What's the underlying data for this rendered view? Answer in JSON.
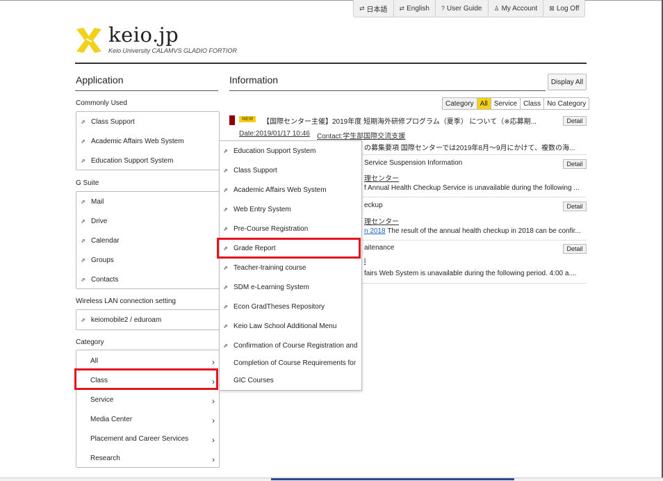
{
  "topnav": [
    {
      "icon": "swap-icon",
      "glyph": "⇄",
      "label": "日本語"
    },
    {
      "icon": "swap-icon",
      "glyph": "⇄",
      "label": "English"
    },
    {
      "icon": "help-icon",
      "glyph": "?",
      "label": "User Guide"
    },
    {
      "icon": "user-icon",
      "glyph": "♙",
      "label": "My Account"
    },
    {
      "icon": "logout-icon",
      "glyph": "⊠",
      "label": "Log Off"
    }
  ],
  "brand": {
    "name": "keio.jp",
    "tagline": "Keio University CALAMVS GLADIO FORTIOR",
    "accent": "#f2d11c"
  },
  "application": {
    "title": "Application",
    "commonly_used_label": "Commonly Used",
    "commonly_used": [
      "Class Support",
      "Academic Affairs Web System",
      "Education Support System"
    ],
    "gsuite_label": "G Suite",
    "gsuite": [
      "Mail",
      "Drive",
      "Calendar",
      "Groups",
      "Contacts"
    ],
    "wireless_label": "Wireless LAN connection setting",
    "wireless": [
      "keiomobile2 / eduroam"
    ],
    "category_label": "Category",
    "categories": [
      "All",
      "Class",
      "Service",
      "Media Center",
      "Placement and Career Services",
      "Research"
    ]
  },
  "information": {
    "title": "Information",
    "display_all": "Display All",
    "filters": [
      "Category",
      "All",
      "Service",
      "Class",
      "No Category"
    ],
    "detail_label": "Detail",
    "news": [
      {
        "badge": "NEW",
        "title": "【国際センター主催】2019年度 短期海外研修プログラム（夏季） について（※応募期...",
        "date": "Date:2019/01/17 10:46",
        "contact": "Contact:学生部国際交流支援",
        "body": "の募集要項 国際センターでは2019年8月～9月にかけて、複数の海..."
      },
      {
        "title": "Service Suspension Information",
        "contact": "理センター",
        "body": "f Annual Health Checkup Service is unavailable during the following ..."
      },
      {
        "title": "eckup",
        "contact": "理センター",
        "link": "n 2018",
        "body": "The result of the annual health checkup in 2018 can be confir..."
      },
      {
        "title": "aitenance",
        "contact": "l",
        "body": "fairs Web System is unavailable during the following period. 4:00 a...."
      }
    ]
  },
  "dropdown": {
    "items": [
      "Education Support System",
      "Class Support",
      "Academic Affairs Web System",
      "Web Entry System",
      "Pre-Course Registration",
      "Grade Report",
      "Teacher-training course",
      "SDM e-Learning System",
      "Econ GradTheses Repository",
      "Keio Law School Additional Menu",
      "Confirmation of Course Registration and",
      "Completion of Course Requirements for",
      "GIC Courses"
    ]
  },
  "colors": {
    "highlight": "#e3141c",
    "new_marker": "#8b0000",
    "new_badge": "#f2d11c"
  }
}
